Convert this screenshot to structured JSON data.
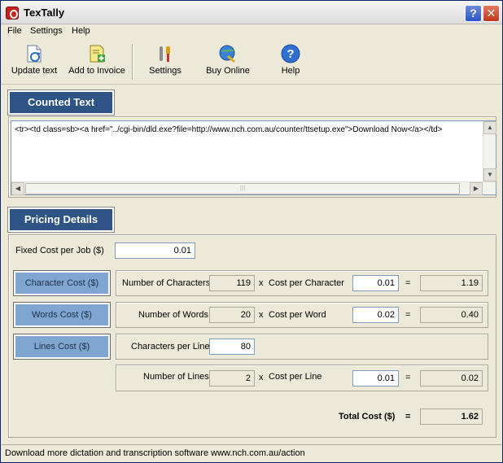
{
  "window": {
    "title": "TexTally"
  },
  "menu": [
    "File",
    "Settings",
    "Help"
  ],
  "toolbar": {
    "update": "Update text",
    "invoice": "Add to Invoice",
    "settings": "Settings",
    "buy": "Buy Online",
    "help": "Help"
  },
  "counted": {
    "tab": "Counted Text",
    "text": "<tr><td class=sb><a href=\"../cgi-bin/dld.exe?file=http://www.nch.com.au/counter/ttsetup.exe\">Download Now</a></td>"
  },
  "pricing": {
    "tab": "Pricing Details",
    "fixed_label": "Fixed Cost per Job ($)",
    "fixed_value": "0.01",
    "char_btn": "Character Cost ($)",
    "words_btn": "Words Cost ($)",
    "lines_btn": "Lines Cost ($)",
    "num_chars_label": "Number of Characters",
    "num_chars": "119",
    "cost_per_char_label": "Cost per Character",
    "cost_per_char": "0.01",
    "char_total": "1.19",
    "num_words_label": "Number of Words",
    "num_words": "20",
    "cost_per_word_label": "Cost per Word",
    "cost_per_word": "0.02",
    "word_total": "0.40",
    "chars_per_line_label": "Characters per Line",
    "chars_per_line": "80",
    "num_lines_label": "Number of Lines",
    "num_lines": "2",
    "cost_per_line_label": "Cost per Line",
    "cost_per_line": "0.01",
    "line_total": "0.02",
    "times": "x",
    "equals": "=",
    "total_label": "Total Cost ($)",
    "total_value": "1.62"
  },
  "status": {
    "text": "Download more dictation and transcription software www.nch.com.au/action"
  }
}
